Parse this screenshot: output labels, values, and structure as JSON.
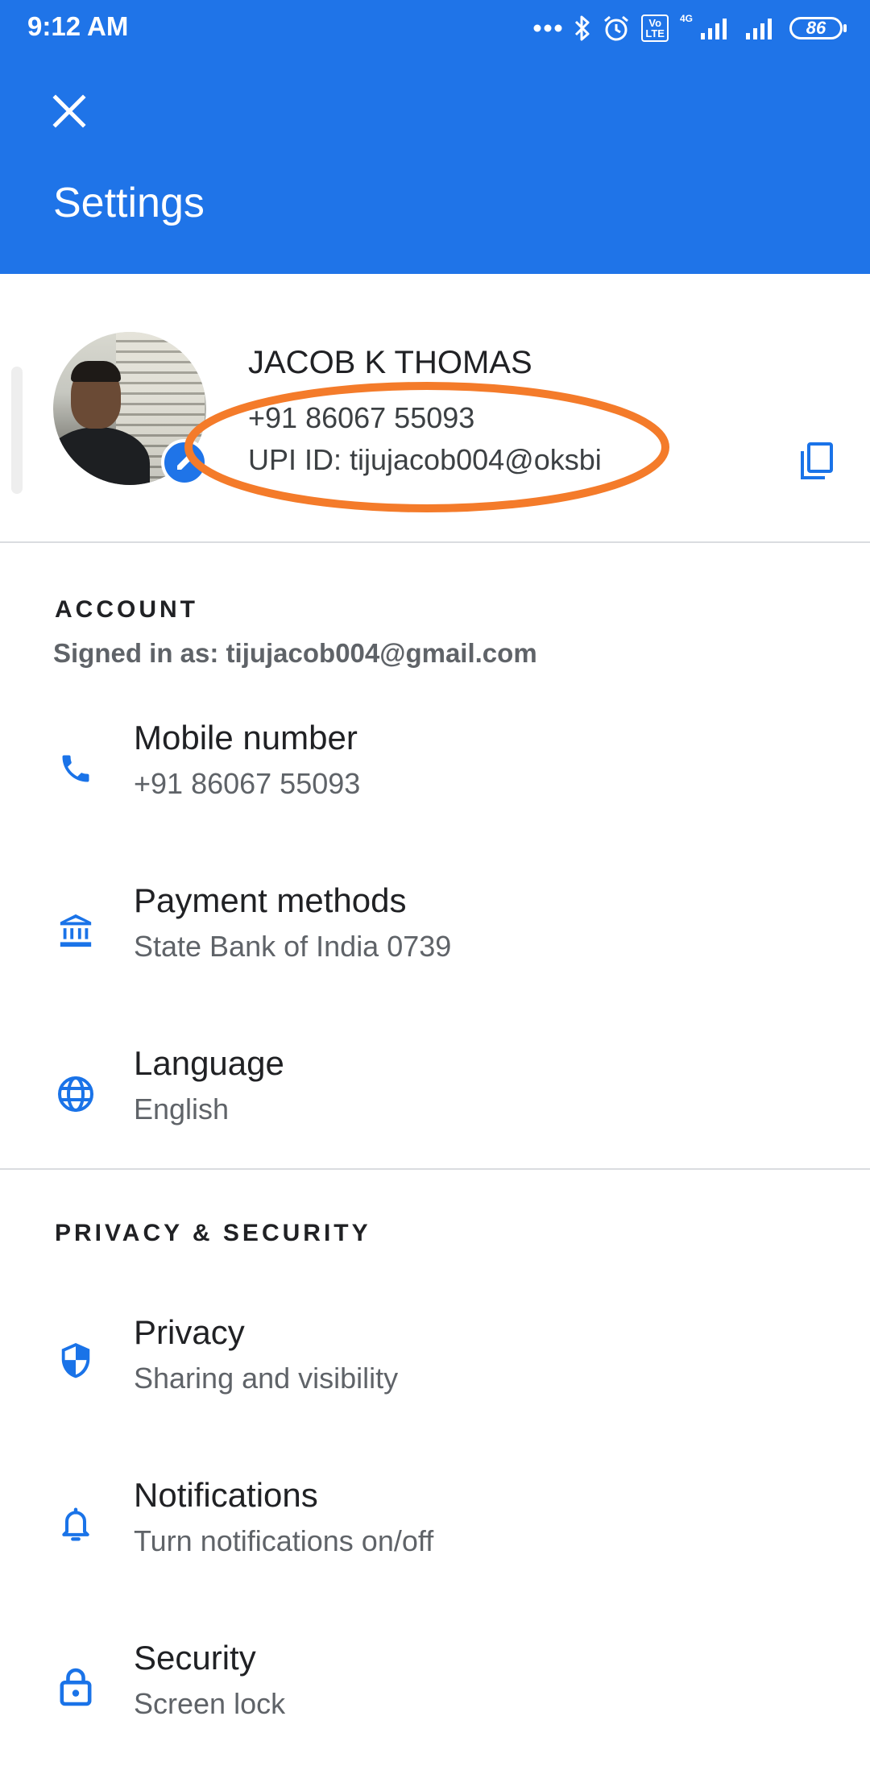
{
  "status_bar": {
    "time": "9:12 AM",
    "network_label": "4G",
    "lte_label": "Vo LTE",
    "battery": "86"
  },
  "header": {
    "title": "Settings",
    "close_icon": "close-icon",
    "background_color": "#1f74e8"
  },
  "profile": {
    "name": "JACOB K THOMAS",
    "phone": "+91 86067 55093",
    "upi": "UPI ID: tijujacob004@oksbi",
    "highlight_color": "#f47b2a",
    "icons": [
      "edit-icon",
      "copy-icon"
    ]
  },
  "account": {
    "header": "ACCOUNT",
    "signed_in": "Signed in as: tijujacob004@gmail.com",
    "items": [
      {
        "icon": "phone-icon",
        "title": "Mobile number",
        "subtitle": "+91 86067 55093"
      },
      {
        "icon": "bank-icon",
        "title": "Payment methods",
        "subtitle": "State Bank of India 0739"
      },
      {
        "icon": "globe-icon",
        "title": "Language",
        "subtitle": "English"
      }
    ]
  },
  "privacy_security": {
    "header": "PRIVACY & SECURITY",
    "items": [
      {
        "icon": "shield-icon",
        "title": "Privacy",
        "subtitle": "Sharing and visibility"
      },
      {
        "icon": "bell-icon",
        "title": "Notifications",
        "subtitle": "Turn notifications on/off"
      },
      {
        "icon": "lock-icon",
        "title": "Security",
        "subtitle": "Screen lock"
      }
    ]
  },
  "accent_color": "#1a73e8"
}
